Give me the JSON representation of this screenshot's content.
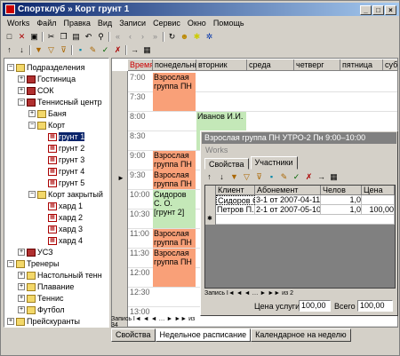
{
  "window": {
    "title": "Спортклуб » Корт грунт 1",
    "controls": [
      "_",
      "□",
      "×"
    ]
  },
  "menu": [
    "Works",
    "Файл",
    "Правка",
    "Вид",
    "Записи",
    "Сервис",
    "Окно",
    "Помощь"
  ],
  "tree": [
    {
      "label": "Подразделения",
      "level": 0,
      "type": "folder",
      "exp": "−"
    },
    {
      "label": "Гостиница",
      "level": 1,
      "type": "house",
      "exp": "+"
    },
    {
      "label": "СОК",
      "level": 1,
      "type": "house",
      "exp": "+"
    },
    {
      "label": "Теннисный центр",
      "level": 1,
      "type": "house",
      "exp": "−"
    },
    {
      "label": "Баня",
      "level": 2,
      "type": "folder",
      "exp": "+"
    },
    {
      "label": "Корт",
      "level": 2,
      "type": "folder",
      "exp": "−"
    },
    {
      "label": "грунт 1",
      "level": 3,
      "type": "cal",
      "selected": true
    },
    {
      "label": "грунт 2",
      "level": 3,
      "type": "cal"
    },
    {
      "label": "грунт 3",
      "level": 3,
      "type": "cal"
    },
    {
      "label": "грунт 4",
      "level": 3,
      "type": "cal"
    },
    {
      "label": "грунт 5",
      "level": 3,
      "type": "cal"
    },
    {
      "label": "Корт закрытый",
      "level": 2,
      "type": "folder",
      "exp": "−"
    },
    {
      "label": "хард 1",
      "level": 3,
      "type": "cal"
    },
    {
      "label": "хард 2",
      "level": 3,
      "type": "cal"
    },
    {
      "label": "хард 3",
      "level": 3,
      "type": "cal"
    },
    {
      "label": "хард 4",
      "level": 3,
      "type": "cal"
    },
    {
      "label": "УСЗ",
      "level": 1,
      "type": "house",
      "exp": "+"
    },
    {
      "label": "Тренеры",
      "level": 0,
      "type": "folder",
      "exp": "−"
    },
    {
      "label": "Настольный тенн",
      "level": 1,
      "type": "folder",
      "exp": "+"
    },
    {
      "label": "Плавание",
      "level": 1,
      "type": "folder",
      "exp": "+"
    },
    {
      "label": "Теннис",
      "level": 1,
      "type": "folder",
      "exp": "+"
    },
    {
      "label": "Футбол",
      "level": 1,
      "type": "folder",
      "exp": "+"
    },
    {
      "label": "Прейскуранты",
      "level": 0,
      "type": "folder",
      "exp": "+"
    }
  ],
  "schedule": {
    "headers": [
      "Время",
      "понедельник",
      "вторник",
      "среда",
      "четверг",
      "пятница",
      "суббо"
    ],
    "times": [
      "7:00",
      "7:30",
      "8:00",
      "8:30",
      "9:00",
      "9:30",
      "10:00",
      "10:30",
      "11:00",
      "11:30",
      "12:00",
      "12:30",
      "13:00"
    ],
    "events": [
      {
        "text": "Взрослая группа ПН",
        "col": 1,
        "start": 0,
        "span": 2,
        "color": "or"
      },
      {
        "text": "Иванов И.И.",
        "col": 2,
        "start": 2,
        "span": 2,
        "color": "gr"
      },
      {
        "text": "Взрослая группа ПН",
        "col": 1,
        "start": 4,
        "span": 2,
        "color": "or"
      },
      {
        "text": "Взрослая группа ПН",
        "col": 1,
        "start": 5,
        "span": 1,
        "color": "or"
      },
      {
        "text": "Сидоров С. О. [грунт 2]",
        "col": 1,
        "start": 6,
        "span": 2,
        "color": "gr"
      },
      {
        "text": "Взрослая группа ПН",
        "col": 1,
        "start": 8,
        "span": 1,
        "color": "or"
      },
      {
        "text": "Взрослая группа ПН",
        "col": 1,
        "start": 9,
        "span": 2,
        "color": "or"
      }
    ]
  },
  "popup": {
    "title": "Взрослая группа ПН УТРО-2 Пн 9:00–10:00",
    "subtitle": "Works",
    "tabs": [
      "Свойства",
      "Участники"
    ],
    "columns": [
      "Клиент",
      "Абонемент",
      "Челов",
      "Цена"
    ],
    "rows": [
      [
        "Сидоров С.",
        "3-1 от 2007-04-11",
        "1,0",
        ""
      ],
      [
        "Петров П.П.",
        "2-1 от 2007-05-10",
        "1,0",
        "100,00"
      ]
    ],
    "nav": "Запись I◄ ◄ ◄ … ► ►► из 2",
    "price_label": "Цена услуги",
    "price_value": "100,00",
    "total_label": "Всего",
    "total_value": "100,00"
  },
  "statusbar": "Запись I◄ ◄ ◄ … ► ►► из 34",
  "bottom_tabs": [
    "Свойства",
    "Недельное расписание",
    "Календарное на неделю"
  ]
}
